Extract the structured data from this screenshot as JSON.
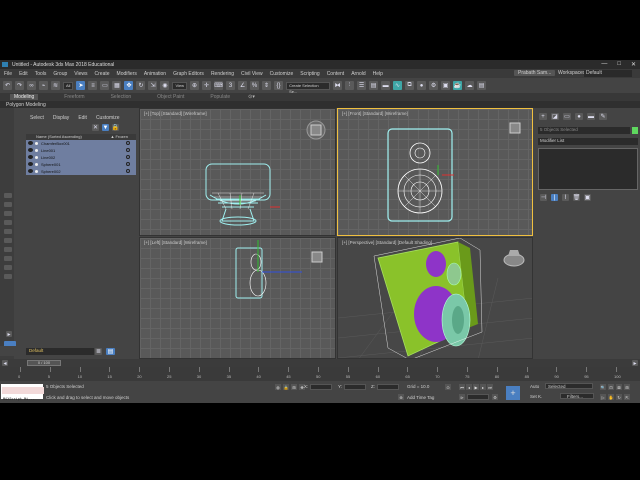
{
  "window": {
    "title": "Untitled - Autodesk 3ds Max 2018 Educational",
    "controls": [
      "—",
      "□",
      "✕"
    ]
  },
  "menu": [
    "File",
    "Edit",
    "Tools",
    "Group",
    "Views",
    "Create",
    "Modifiers",
    "Animation",
    "Graph Editors",
    "Rendering",
    "Civil View",
    "Customize",
    "Scripting",
    "Content",
    "Arnold",
    "Help"
  ],
  "user": "Prabath Sam...",
  "workspaces": {
    "label": "Workspaces:",
    "value": "Default"
  },
  "toolbar": {
    "filter": "All",
    "refcoord": "View",
    "selset": "Create Selection Se..."
  },
  "ribbon": {
    "tabs": [
      "Modeling",
      "Freeform",
      "Selection",
      "Object Paint",
      "Populate"
    ],
    "sub": "Polygon Modeling"
  },
  "explorer": {
    "tabs": [
      "Select",
      "Display",
      "Edit",
      "Customize"
    ],
    "col_name": "Name (Sorted Ascending)",
    "col_frozen": "▲ Frozen",
    "items": [
      "ChamferBox001",
      "Line001",
      "Line002",
      "Sphere001",
      "Sphere002"
    ],
    "layer": "Default"
  },
  "viewports": {
    "top": "[+] [Top] [Standard] [Wireframe]",
    "front": "[+] [Front] [Standard] [Wireframe]",
    "left": "[+] [Left] [Standard] [Wireframe]",
    "persp": "[+] [Perspective] [Standard] [Default Shading]"
  },
  "command": {
    "selection": "5 Objects Selected",
    "modlist": "Modifier List"
  },
  "timeline": {
    "frame": "0 / 100",
    "ticks": [
      "0",
      "5",
      "10",
      "15",
      "20",
      "25",
      "30",
      "35",
      "40",
      "45",
      "50",
      "55",
      "60",
      "65",
      "70",
      "75",
      "80",
      "85",
      "90",
      "95",
      "100"
    ]
  },
  "status": {
    "maxscript": "MAXScript Mi...",
    "selected": "5 Objects Selected",
    "prompt": "Click and drag to select and move objects",
    "x": "X:",
    "y": "Y:",
    "z": "Z:",
    "grid": "Grid = 10.0",
    "addtime": "Add Time Tag",
    "auto": "Auto",
    "selected_dd": "Selected",
    "setk": "Set K.",
    "filters": "Filters..."
  },
  "colors": {
    "accent": "#4a7fc1",
    "wire_cyan": "#9ff0f0",
    "green_mesh": "#8ac22a",
    "purple_mesh": "#8e34c8",
    "selection": "#f0c040"
  }
}
